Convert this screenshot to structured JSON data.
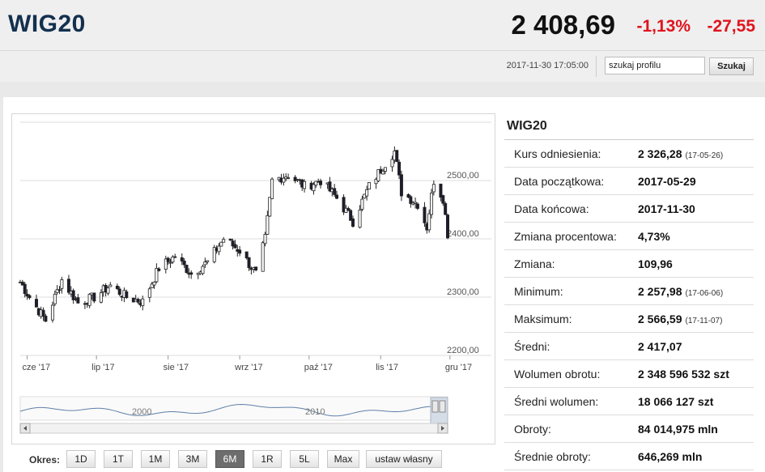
{
  "header": {
    "title": "WIG20",
    "price": "2 408,69",
    "change_pct": "-1,13%",
    "change_abs": "-27,55"
  },
  "subbar": {
    "timestamp": "2017-11-30 17:05:00",
    "search_value": "szukaj profilu",
    "search_button": "Szukaj"
  },
  "colors": {
    "negative": "#e0141e",
    "title": "#13304e",
    "candle_down": "#1d1d2e",
    "candle_up": "#ffffff",
    "navigator_line": "#5e7fa8"
  },
  "chart_data": {
    "type": "candlestick",
    "x_ticks": [
      "cze '17",
      "lip '17",
      "sie '17",
      "wrz '17",
      "paź '17",
      "lis '17",
      "gru '17"
    ],
    "x_tick_dates": [
      "2017-06-01",
      "2017-07-01",
      "2017-08-01",
      "2017-09-01",
      "2017-10-01",
      "2017-11-01",
      "2017-12-01"
    ],
    "y_ticks": [
      {
        "value": 2500,
        "label": "2500,00"
      },
      {
        "value": 2400,
        "label": "2400,00"
      },
      {
        "value": 2300,
        "label": "2300,00"
      },
      {
        "value": 2200,
        "label": "2200,00"
      }
    ],
    "ylim": [
      2200,
      2600
    ],
    "x_range": [
      "2017-05-29",
      "2017-11-30"
    ],
    "grid": true,
    "series_close": [
      [
        "2017-05-29",
        2326
      ],
      [
        "2017-06-02",
        2300
      ],
      [
        "2017-06-09",
        2260
      ],
      [
        "2017-06-16",
        2330
      ],
      [
        "2017-06-23",
        2290
      ],
      [
        "2017-06-30",
        2300
      ],
      [
        "2017-07-07",
        2320
      ],
      [
        "2017-07-14",
        2300
      ],
      [
        "2017-07-21",
        2292
      ],
      [
        "2017-07-28",
        2350
      ],
      [
        "2017-08-04",
        2370
      ],
      [
        "2017-08-11",
        2340
      ],
      [
        "2017-08-18",
        2360
      ],
      [
        "2017-08-25",
        2400
      ],
      [
        "2017-09-01",
        2380
      ],
      [
        "2017-09-08",
        2340
      ],
      [
        "2017-09-12",
        2400
      ],
      [
        "2017-09-15",
        2500
      ],
      [
        "2017-09-22",
        2510
      ],
      [
        "2017-09-29",
        2490
      ],
      [
        "2017-10-06",
        2500
      ],
      [
        "2017-10-13",
        2470
      ],
      [
        "2017-10-20",
        2430
      ],
      [
        "2017-10-27",
        2490
      ],
      [
        "2017-11-03",
        2530
      ],
      [
        "2017-11-07",
        2550
      ],
      [
        "2017-11-10",
        2480
      ],
      [
        "2017-11-17",
        2460
      ],
      [
        "2017-11-21",
        2420
      ],
      [
        "2017-11-24",
        2500
      ],
      [
        "2017-11-28",
        2470
      ],
      [
        "2017-11-30",
        2409
      ]
    ],
    "navigator": {
      "labels": [
        "2000",
        "2010"
      ]
    }
  },
  "periods": {
    "label": "Okres:",
    "buttons": [
      "1D",
      "1T",
      "1M",
      "3M",
      "6M",
      "1R",
      "5L",
      "Max",
      "ustaw własny"
    ],
    "active": "6M"
  },
  "stats": {
    "title": "WIG20",
    "rows": [
      {
        "label": "Kurs odniesienia:",
        "value": "2 326,28",
        "sub": "(17-05-26)"
      },
      {
        "label": "Data początkowa:",
        "value": "2017-05-29",
        "sub": ""
      },
      {
        "label": "Data końcowa:",
        "value": "2017-11-30",
        "sub": ""
      },
      {
        "label": "Zmiana procentowa:",
        "value": "4,73%",
        "sub": ""
      },
      {
        "label": "Zmiana:",
        "value": "109,96",
        "sub": ""
      },
      {
        "label": "Minimum:",
        "value": "2 257,98",
        "sub": "(17-06-06)"
      },
      {
        "label": "Maksimum:",
        "value": "2 566,59",
        "sub": "(17-11-07)"
      },
      {
        "label": "Średni:",
        "value": "2 417,07",
        "sub": ""
      },
      {
        "label": "Wolumen obrotu:",
        "value": "2 348 596 532 szt",
        "sub": ""
      },
      {
        "label": "Średni wolumen:",
        "value": "18 066 127 szt",
        "sub": ""
      },
      {
        "label": "Obroty:",
        "value": "84 014,975 mln",
        "sub": ""
      },
      {
        "label": "Średnie obroty:",
        "value": "646,269 mln",
        "sub": ""
      }
    ]
  }
}
